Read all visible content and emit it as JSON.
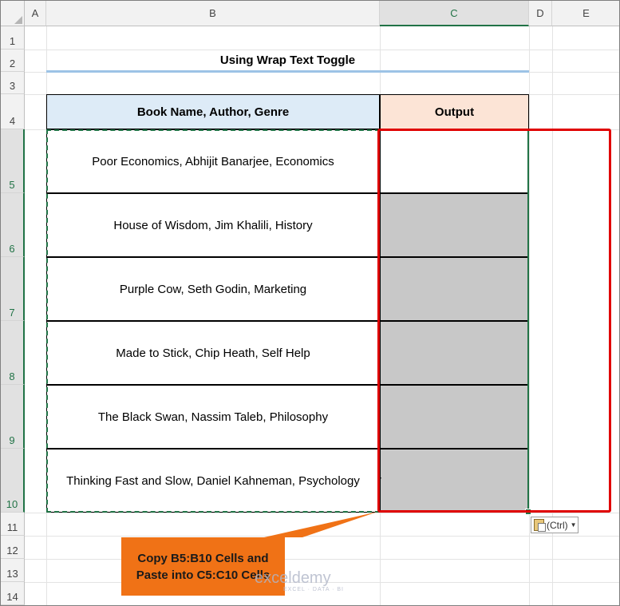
{
  "columns": [
    "A",
    "B",
    "C",
    "D",
    "E"
  ],
  "rows": [
    "1",
    "2",
    "3",
    "4",
    "5",
    "6",
    "7",
    "8",
    "9",
    "10",
    "11",
    "12",
    "13",
    "14"
  ],
  "title": "Using Wrap Text Toggle",
  "headers": {
    "b": "Book Name, Author, Genre",
    "c": "Output"
  },
  "books": [
    "Poor Economics, Abhijit Banarjee, Economics",
    "House of Wisdom, Jim Khalili, History",
    "Purple Cow, Seth Godin, Marketing",
    "Made to Stick, Chip Heath, Self Help",
    "The Black Swan, Nassim Taleb, Philosophy",
    "Thinking Fast and Slow, Daniel Kahneman, Psychology"
  ],
  "callout": {
    "line1": "Copy B5:B10 Cells and",
    "line2": "Paste into C5:C10 Cells"
  },
  "paste_options": "(Ctrl)",
  "watermark": {
    "name": "exceldemy",
    "tagline": "EXCEL · DATA · BI"
  },
  "colors": {
    "header_b": "#ddebf7",
    "header_c": "#fce4d6",
    "selection_fill": "#c8c8c8",
    "accent": "#217346",
    "highlight": "#e00000",
    "callout": "#f07216"
  }
}
